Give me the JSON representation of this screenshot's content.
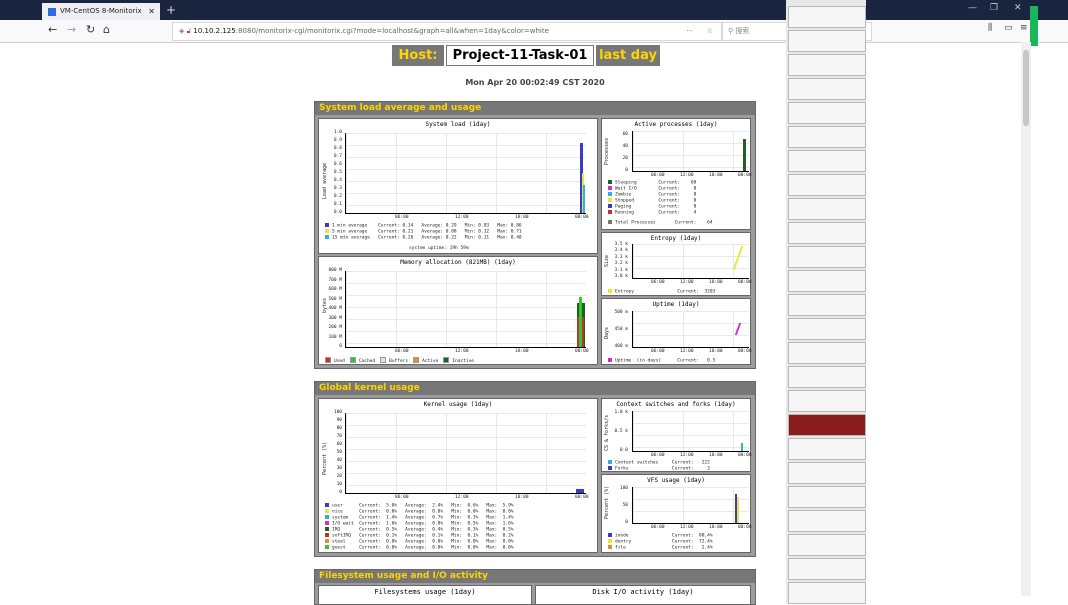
{
  "browser": {
    "tab_title": "VM-CentOS 8-Monitorix",
    "url_host": "10.10.2.125",
    "url_path": ":8080/monitorix-cgi/monitorix.cgi?mode=localhost&graph=all&when=1day&color=white",
    "search_placeholder": "搜索"
  },
  "header": {
    "host_label": "Host:",
    "host_name": "Project-11-Task-01",
    "period": "last day",
    "timestamp": "Mon Apr 20 00:02:49 CST 2020"
  },
  "sections": {
    "system": "System load average and usage",
    "kernel": "Global kernel usage",
    "filesystem": "Filesystem usage and I/O activity"
  },
  "system_load": {
    "title": "System load  (1day)",
    "ylabel": "Load average",
    "yticks": [
      "1.0",
      "0.9",
      "0.8",
      "0.7",
      "0.6",
      "0.5",
      "0.4",
      "0.3",
      "0.2",
      "0.1",
      "0.0"
    ],
    "xticks": [
      "06:00",
      "12:00",
      "18:00",
      "00:00"
    ],
    "legend": [
      {
        "text": "1 min average    Current: 0.14   Average: 0.29   Min: 0.03   Max: 0.86",
        "color": "#3a3ac8"
      },
      {
        "text": "5 min average    Current: 0.21   Average: 0.08   Min: 0.12   Max: 0.71",
        "color": "#e8e830"
      },
      {
        "text": "15 min average   Current: 0.26   Average: 0.22   Min: 0.11   Max: 0.40",
        "color": "#30b0e0"
      }
    ],
    "uptime_note": "system uptime:  19h 59m"
  },
  "memory": {
    "title": "Memory allocation (821MB)  (1day)",
    "ylabel": "bytes",
    "yticks": [
      "800 M",
      "700 M",
      "600 M",
      "500 M",
      "400 M",
      "300 M",
      "200 M",
      "100 M",
      "0"
    ],
    "xticks": [
      "06:00",
      "12:00",
      "18:00",
      "00:00"
    ],
    "legend": [
      {
        "text": "Used",
        "color": "#c83030"
      },
      {
        "text": "Cached",
        "color": "#30c830"
      },
      {
        "text": "Buffers",
        "color": "#e0e0e0"
      },
      {
        "text": "Active",
        "color": "#e09030"
      },
      {
        "text": "Inactive",
        "color": "#206020"
      }
    ]
  },
  "processes": {
    "title": "Active processes  (1day)",
    "ylabel": "Processes",
    "yticks": [
      "60",
      "40",
      "20",
      "0"
    ],
    "xticks": [
      "06:00",
      "12:00",
      "18:00",
      "00:00"
    ],
    "legend": [
      {
        "text": "Sleeping        Current:    60",
        "color": "#206020"
      },
      {
        "text": "Wait I/O        Current:     0",
        "color": "#c830c8"
      },
      {
        "text": "Zombie          Current:     0",
        "color": "#30b0e0"
      },
      {
        "text": "Stopped         Current:     0",
        "color": "#e8e830"
      },
      {
        "text": "Paging          Current:     0",
        "color": "#3a3ac8"
      },
      {
        "text": "Running         Current:     4",
        "color": "#c83030"
      }
    ],
    "total": "Total Processes       Current:    64"
  },
  "entropy": {
    "title": "Entropy  (1day)",
    "ylabel": "Size",
    "yticks": [
      "3.5 k",
      "3.4 k",
      "3.3 k",
      "3.2 k",
      "3.1 k",
      "3.0 k"
    ],
    "xticks": [
      "06:00",
      "12:00",
      "18:00",
      "00:00"
    ],
    "legend": "Entropy                Current:  3203"
  },
  "uptime": {
    "title": "Uptime  (1day)",
    "ylabel": "Days",
    "yticks": [
      "500 m",
      "450 m",
      "400 m"
    ],
    "xticks": [
      "06:00",
      "12:00",
      "18:00",
      "00:00"
    ],
    "legend": "Uptime  (in days)      Current:   0.5"
  },
  "kernel": {
    "title": "Kernel usage  (1day)",
    "ylabel": "Percent (%)",
    "yticks": [
      "100",
      "90",
      "80",
      "70",
      "60",
      "50",
      "40",
      "30",
      "20",
      "10",
      "0"
    ],
    "xticks": [
      "06:00",
      "12:00",
      "18:00",
      "00:00"
    ],
    "legend": [
      {
        "text": "user      Current:  5.0%   Average:  2.4%   Min:  0.6%   Max:  5.9%",
        "color": "#3a3ac8"
      },
      {
        "text": "nice      Current:  0.0%   Average:  0.0%   Min:  0.0%   Max:  0.0%",
        "color": "#e8e830"
      },
      {
        "text": "system    Current:  1.4%   Average:  0.7%   Min:  0.3%   Max:  1.4%",
        "color": "#30b0e0"
      },
      {
        "text": "I/O wait  Current:  1.6%   Average:  0.8%   Min:  0.5%   Max:  1.6%",
        "color": "#c830c8"
      },
      {
        "text": "IRQ       Current:  0.5%   Average:  0.4%   Min:  0.3%   Max:  0.5%",
        "color": "#206020"
      },
      {
        "text": "softIRQ   Current:  0.1%   Average:  0.1%   Min:  0.1%   Max:  0.2%",
        "color": "#c83030"
      },
      {
        "text": "steal     Current:  0.0%   Average:  0.0%   Min:  0.0%   Max:  0.0%",
        "color": "#e09030"
      },
      {
        "text": "guest     Current:  0.0%   Average:  0.0%   Min:  0.0%   Max:  0.0%",
        "color": "#30c830"
      }
    ]
  },
  "ctx": {
    "title": "Context switches and forks  (1day)",
    "ylabel": "CS & forks/s",
    "yticks": [
      "1.0 k",
      "0.5 k",
      "0.0"
    ],
    "xticks": [
      "06:00",
      "12:00",
      "18:00",
      "00:00"
    ],
    "legend": [
      {
        "text": "Context switches     Current:   222",
        "color": "#30b0e0"
      },
      {
        "text": "Forks                Current:     3",
        "color": "#3a3ac8"
      }
    ]
  },
  "vfs": {
    "title": "VFS usage  (1day)",
    "ylabel": "Percent (%)",
    "yticks": [
      "100",
      "50",
      "0"
    ],
    "xticks": [
      "06:00",
      "12:00",
      "18:00",
      "00:00"
    ],
    "legend": [
      {
        "text": "inode                Current:  80.4%",
        "color": "#3a3ac8"
      },
      {
        "text": "dentry               Current:  72.4%",
        "color": "#e8e830"
      },
      {
        "text": "file                 Current:   2.4%",
        "color": "#e09030"
      }
    ]
  },
  "fs_panels": {
    "left": "Filesystems usage  (1day)",
    "right": "Disk I/O activity  (1day)"
  }
}
